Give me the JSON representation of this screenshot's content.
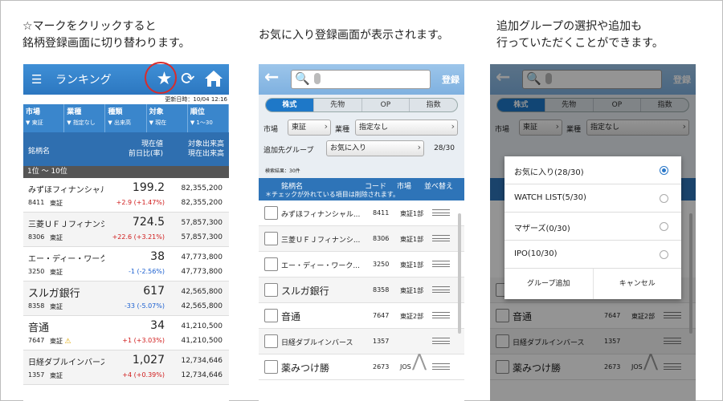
{
  "captions": {
    "panel1_line1": "☆マークをクリックすると",
    "panel1_line2": "銘柄登録画面に切り替わります。",
    "panel2": "お気に入り登録画面が表示されます。",
    "panel3_line1": "追加グループの選択や追加も",
    "panel3_line2": "行っていただくことができます。"
  },
  "ranking": {
    "title": "ランキング",
    "menu_icon": "☰",
    "star_icon": "★",
    "refresh_icon": "⟳",
    "updated": "更新日時：10/04 12:16",
    "filters": [
      {
        "label": "市場",
        "value": "東証"
      },
      {
        "label": "業種",
        "value": "指定なし"
      },
      {
        "label": "種類",
        "value": "出来高"
      },
      {
        "label": "対象",
        "value": "現在"
      },
      {
        "label": "順位",
        "value": "1〜30"
      }
    ],
    "col_name": "銘柄名",
    "col_price1": "現在値",
    "col_price2": "前日比(率)",
    "col_vol1": "対象出来高",
    "col_vol2": "現在出来高",
    "section": "1位 〜 10位",
    "rows": [
      {
        "name": "みずほフィナンシャル...",
        "code": "8411",
        "market": "東証",
        "price": "199.2",
        "change": "+2.9 (+1.47%)",
        "dir": "up",
        "vol1": "82,355,200",
        "vol2": "82,355,200",
        "big": false,
        "warn": ""
      },
      {
        "name": "三菱ＵＦＪフィナンシ...",
        "code": "8306",
        "market": "東証",
        "price": "724.5",
        "change": "+22.6 (+3.21%)",
        "dir": "up",
        "vol1": "57,857,300",
        "vol2": "57,857,300",
        "big": false,
        "warn": ""
      },
      {
        "name": "エー・ディー・ワーク...",
        "code": "3250",
        "market": "東証",
        "price": "38",
        "change": "-1 (-2.56%)",
        "dir": "dn",
        "vol1": "47,773,800",
        "vol2": "47,773,800",
        "big": false,
        "warn": ""
      },
      {
        "name": "スルガ銀行",
        "code": "8358",
        "market": "東証",
        "price": "617",
        "change": "-33 (-5.07%)",
        "dir": "dn",
        "vol1": "42,565,800",
        "vol2": "42,565,800",
        "big": true,
        "warn": ""
      },
      {
        "name": "音通",
        "code": "7647",
        "market": "東証",
        "price": "34",
        "change": "+1 (+3.03%)",
        "dir": "up",
        "vol1": "41,210,500",
        "vol2": "41,210,500",
        "big": true,
        "warn": "⚠"
      },
      {
        "name": "日経ダブルインバース",
        "code": "1357",
        "market": "東証",
        "price": "1,027",
        "change": "+4 (+0.39%)",
        "dir": "up",
        "vol1": "12,734,646",
        "vol2": "12,734,646",
        "big": false,
        "warn": ""
      }
    ]
  },
  "register": {
    "back_icon": "←",
    "search_icon": "🔍",
    "register_label": "登録",
    "tabs": [
      "株式",
      "先物",
      "OP",
      "指数"
    ],
    "market_label": "市場",
    "market_value": "東証",
    "industry_label": "業種",
    "industry_value": "指定なし",
    "group_label": "追加先グループ",
    "group_value": "お気に入り",
    "group_count": "28/30",
    "hits": "検索結果：30件",
    "col_name": "銘柄名",
    "col_code": "コード",
    "col_market": "市場",
    "col_sort": "並べ替え",
    "note": "＊チェックが外れている項目は削除されます。",
    "rows": [
      {
        "name": "みずほフィナンシャル...",
        "code": "8411",
        "market": "東証1部",
        "big": false
      },
      {
        "name": "三菱ＵＦＪフィナンシ...",
        "code": "8306",
        "market": "東証1部",
        "big": false
      },
      {
        "name": "エー・ディー・ワーク...",
        "code": "3250",
        "market": "東証1部",
        "big": false
      },
      {
        "name": "スルガ銀行",
        "code": "8358",
        "market": "東証1部",
        "big": true
      },
      {
        "name": "音通",
        "code": "7647",
        "market": "東証2部",
        "big": true
      },
      {
        "name": "日経ダブルインバース",
        "code": "1357",
        "market": "",
        "big": false
      },
      {
        "name": "薬みつけ勝",
        "code": "2673",
        "market": "JOS",
        "big": true
      }
    ],
    "up_icon": "⋀"
  },
  "dialog": {
    "options": [
      {
        "label": "お気に入り(28/30)",
        "selected": true
      },
      {
        "label": "WATCH LIST(5/30)",
        "selected": false
      },
      {
        "label": "マザーズ(0/30)",
        "selected": false
      },
      {
        "label": "IPO(10/30)",
        "selected": false
      }
    ],
    "add_group": "グループ追加",
    "cancel": "キャンセル"
  }
}
